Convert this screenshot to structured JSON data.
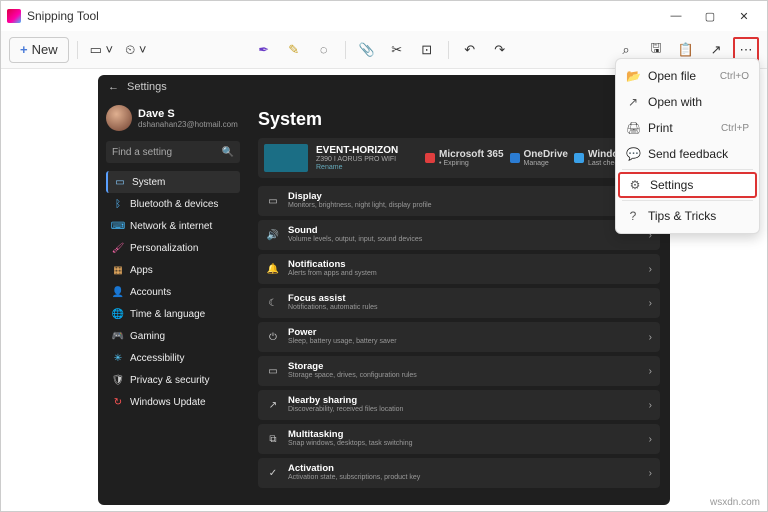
{
  "app": {
    "title": "Snipping Tool",
    "new": "New"
  },
  "winbtns": {
    "min": "—",
    "max": "▢",
    "close": "✕"
  },
  "toolbar": {
    "items": [
      "✚",
      "▭",
      "⏲",
      "│",
      "✎",
      "✎",
      "◌",
      "│",
      "📎",
      "✂",
      "⊡",
      "│",
      "↶",
      "↷"
    ],
    "right": [
      "⌕",
      "🖫",
      "📋",
      "↗",
      "⋯"
    ]
  },
  "menu": {
    "items": [
      {
        "icon": "📂",
        "label": "Open file",
        "short": "Ctrl+O"
      },
      {
        "icon": "↗",
        "label": "Open with",
        "short": ""
      },
      {
        "icon": "🖨",
        "label": "Print",
        "short": "Ctrl+P"
      },
      {
        "icon": "💬",
        "label": "Send feedback",
        "short": ""
      },
      {
        "icon": "⚙",
        "label": "Settings",
        "short": "",
        "hl": true
      },
      {
        "icon": "?",
        "label": "Tips & Tricks",
        "short": ""
      }
    ]
  },
  "settings": {
    "back": "←",
    "crumb": "Settings",
    "user": {
      "name": "Dave S",
      "email": "dshanahan23@hotmail.com"
    },
    "search": "Find a setting",
    "searchIcon": "🔍",
    "nav": [
      {
        "icon": "▭",
        "label": "System",
        "cls": "c-sys",
        "active": true
      },
      {
        "icon": "ᛒ",
        "label": "Bluetooth & devices",
        "cls": "c-bt"
      },
      {
        "icon": "⌨",
        "label": "Network & internet",
        "cls": "c-net"
      },
      {
        "icon": "🖌",
        "label": "Personalization",
        "cls": "c-per"
      },
      {
        "icon": "▦",
        "label": "Apps",
        "cls": "c-app"
      },
      {
        "icon": "👤",
        "label": "Accounts",
        "cls": "c-acc"
      },
      {
        "icon": "🌐",
        "label": "Time & language",
        "cls": "c-time"
      },
      {
        "icon": "🎮",
        "label": "Gaming",
        "cls": "c-game"
      },
      {
        "icon": "✳",
        "label": "Accessibility",
        "cls": "c-a11y"
      },
      {
        "icon": "🛡",
        "label": "Privacy & security",
        "cls": "c-priv"
      },
      {
        "icon": "↻",
        "label": "Windows Update",
        "cls": "c-upd"
      }
    ],
    "title": "System",
    "hero": {
      "name": "EVENT-HORIZON",
      "sub": "Z390 I AORUS PRO WIFI",
      "rename": "Rename",
      "svc": [
        {
          "color": "#e03e3e",
          "t1": "Microsoft 365",
          "t2": "• Expiring"
        },
        {
          "color": "#2b7cd3",
          "t1": "OneDrive",
          "t2": "Manage"
        },
        {
          "color": "#3aa0e8",
          "t1": "Windows Upd",
          "t2": "Last checked: 1 h"
        }
      ]
    },
    "rows": [
      {
        "icon": "▭",
        "t": "Display",
        "s": "Monitors, brightness, night light, display profile"
      },
      {
        "icon": "🔊",
        "t": "Sound",
        "s": "Volume levels, output, input, sound devices"
      },
      {
        "icon": "🔔",
        "t": "Notifications",
        "s": "Alerts from apps and system"
      },
      {
        "icon": "☾",
        "t": "Focus assist",
        "s": "Notifications, automatic rules"
      },
      {
        "icon": "⏻",
        "t": "Power",
        "s": "Sleep, battery usage, battery saver"
      },
      {
        "icon": "▭",
        "t": "Storage",
        "s": "Storage space, drives, configuration rules"
      },
      {
        "icon": "↗",
        "t": "Nearby sharing",
        "s": "Discoverability, received files location"
      },
      {
        "icon": "⧉",
        "t": "Multitasking",
        "s": "Snap windows, desktops, task switching"
      },
      {
        "icon": "✓",
        "t": "Activation",
        "s": "Activation state, subscriptions, product key"
      }
    ]
  },
  "watermark": "wsxdn.com"
}
